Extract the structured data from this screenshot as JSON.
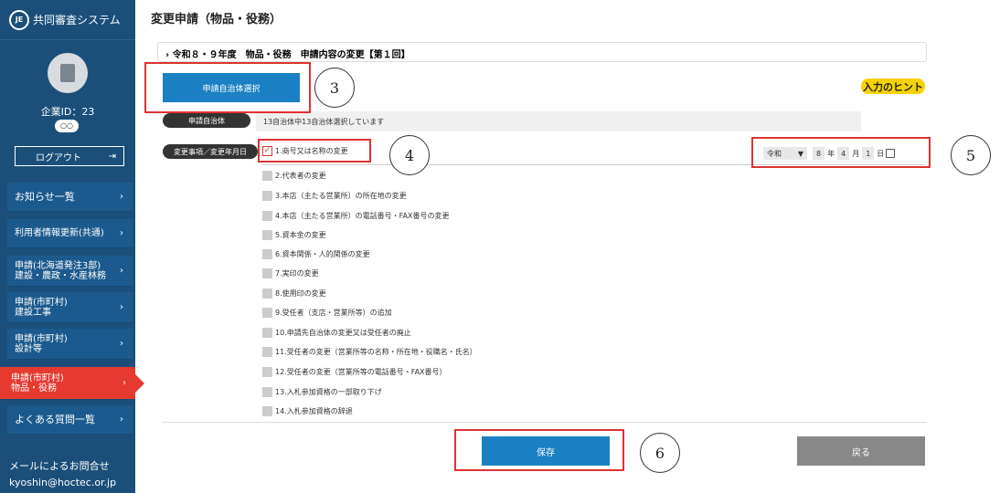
{
  "sidebar": {
    "system_title": "共同審査システム",
    "logo_text": "JE",
    "company_id": "企業ID：23",
    "company_value": "○○",
    "logout": "ログアウト",
    "logout_icon": "⇥",
    "chevron": "›",
    "items": [
      {
        "label": "お知らせ一覧"
      },
      {
        "label": "利用者情報更新(共通)"
      },
      {
        "label": "申請(北海道発注3部)\n建設・農政・水産林務"
      },
      {
        "label": "申請(市町村)\n建設工事"
      },
      {
        "label": "申請(市町村)\n設計等"
      },
      {
        "label": "申請(市町村)\n物品・役務"
      },
      {
        "label": "よくある質問一覧"
      }
    ],
    "contact_title": "メールによるお問合せ",
    "contact_email": "kyoshin@hoctec.or.jp"
  },
  "main": {
    "title": "変更申請（物品・役務）",
    "breadcrumb": "› 令和８・９年度　物品・役務　申請内容の変更【第１回】",
    "select_button": "申請自治体選択",
    "hint": "入力のヒント",
    "muni_label": "申請自治体",
    "muni_text": "13自治体中13自治体選択しています",
    "change_label": "変更事項／変更年月日",
    "items": [
      "1.商号又は名称の変更",
      "2.代表者の変更",
      "3.本店（主たる営業所）の所在地の変更",
      "4.本店（主たる営業所）の電話番号・FAX番号の変更",
      "5.資本金の変更",
      "6.資本関係・人的関係の変更",
      "7.実印の変更",
      "8.使用印の変更",
      "9.受任者（支店・営業所等）の追加",
      "10.申請先自治体の変更又は受任者の廃止",
      "11.受任者の変更（営業所等の名称・所在地・役職名・氏名）",
      "12.受任者の変更（営業所等の電話番号・FAX番号）",
      "13.入札参加資格の一部取り下げ",
      "14.入札参加資格の辞退"
    ],
    "checked_index": 0,
    "date": {
      "era": "令和",
      "year": "8",
      "year_unit": "年",
      "month": "4",
      "month_unit": "月",
      "day": "1",
      "day_unit": "日"
    },
    "save": "保存",
    "back": "戻る"
  },
  "annotations": [
    "3",
    "4",
    "5",
    "6"
  ],
  "colors": {
    "sidebar": "#1b4f7a",
    "active": "#e63a30",
    "primary": "#1b80c4",
    "annotation": "#d33"
  }
}
